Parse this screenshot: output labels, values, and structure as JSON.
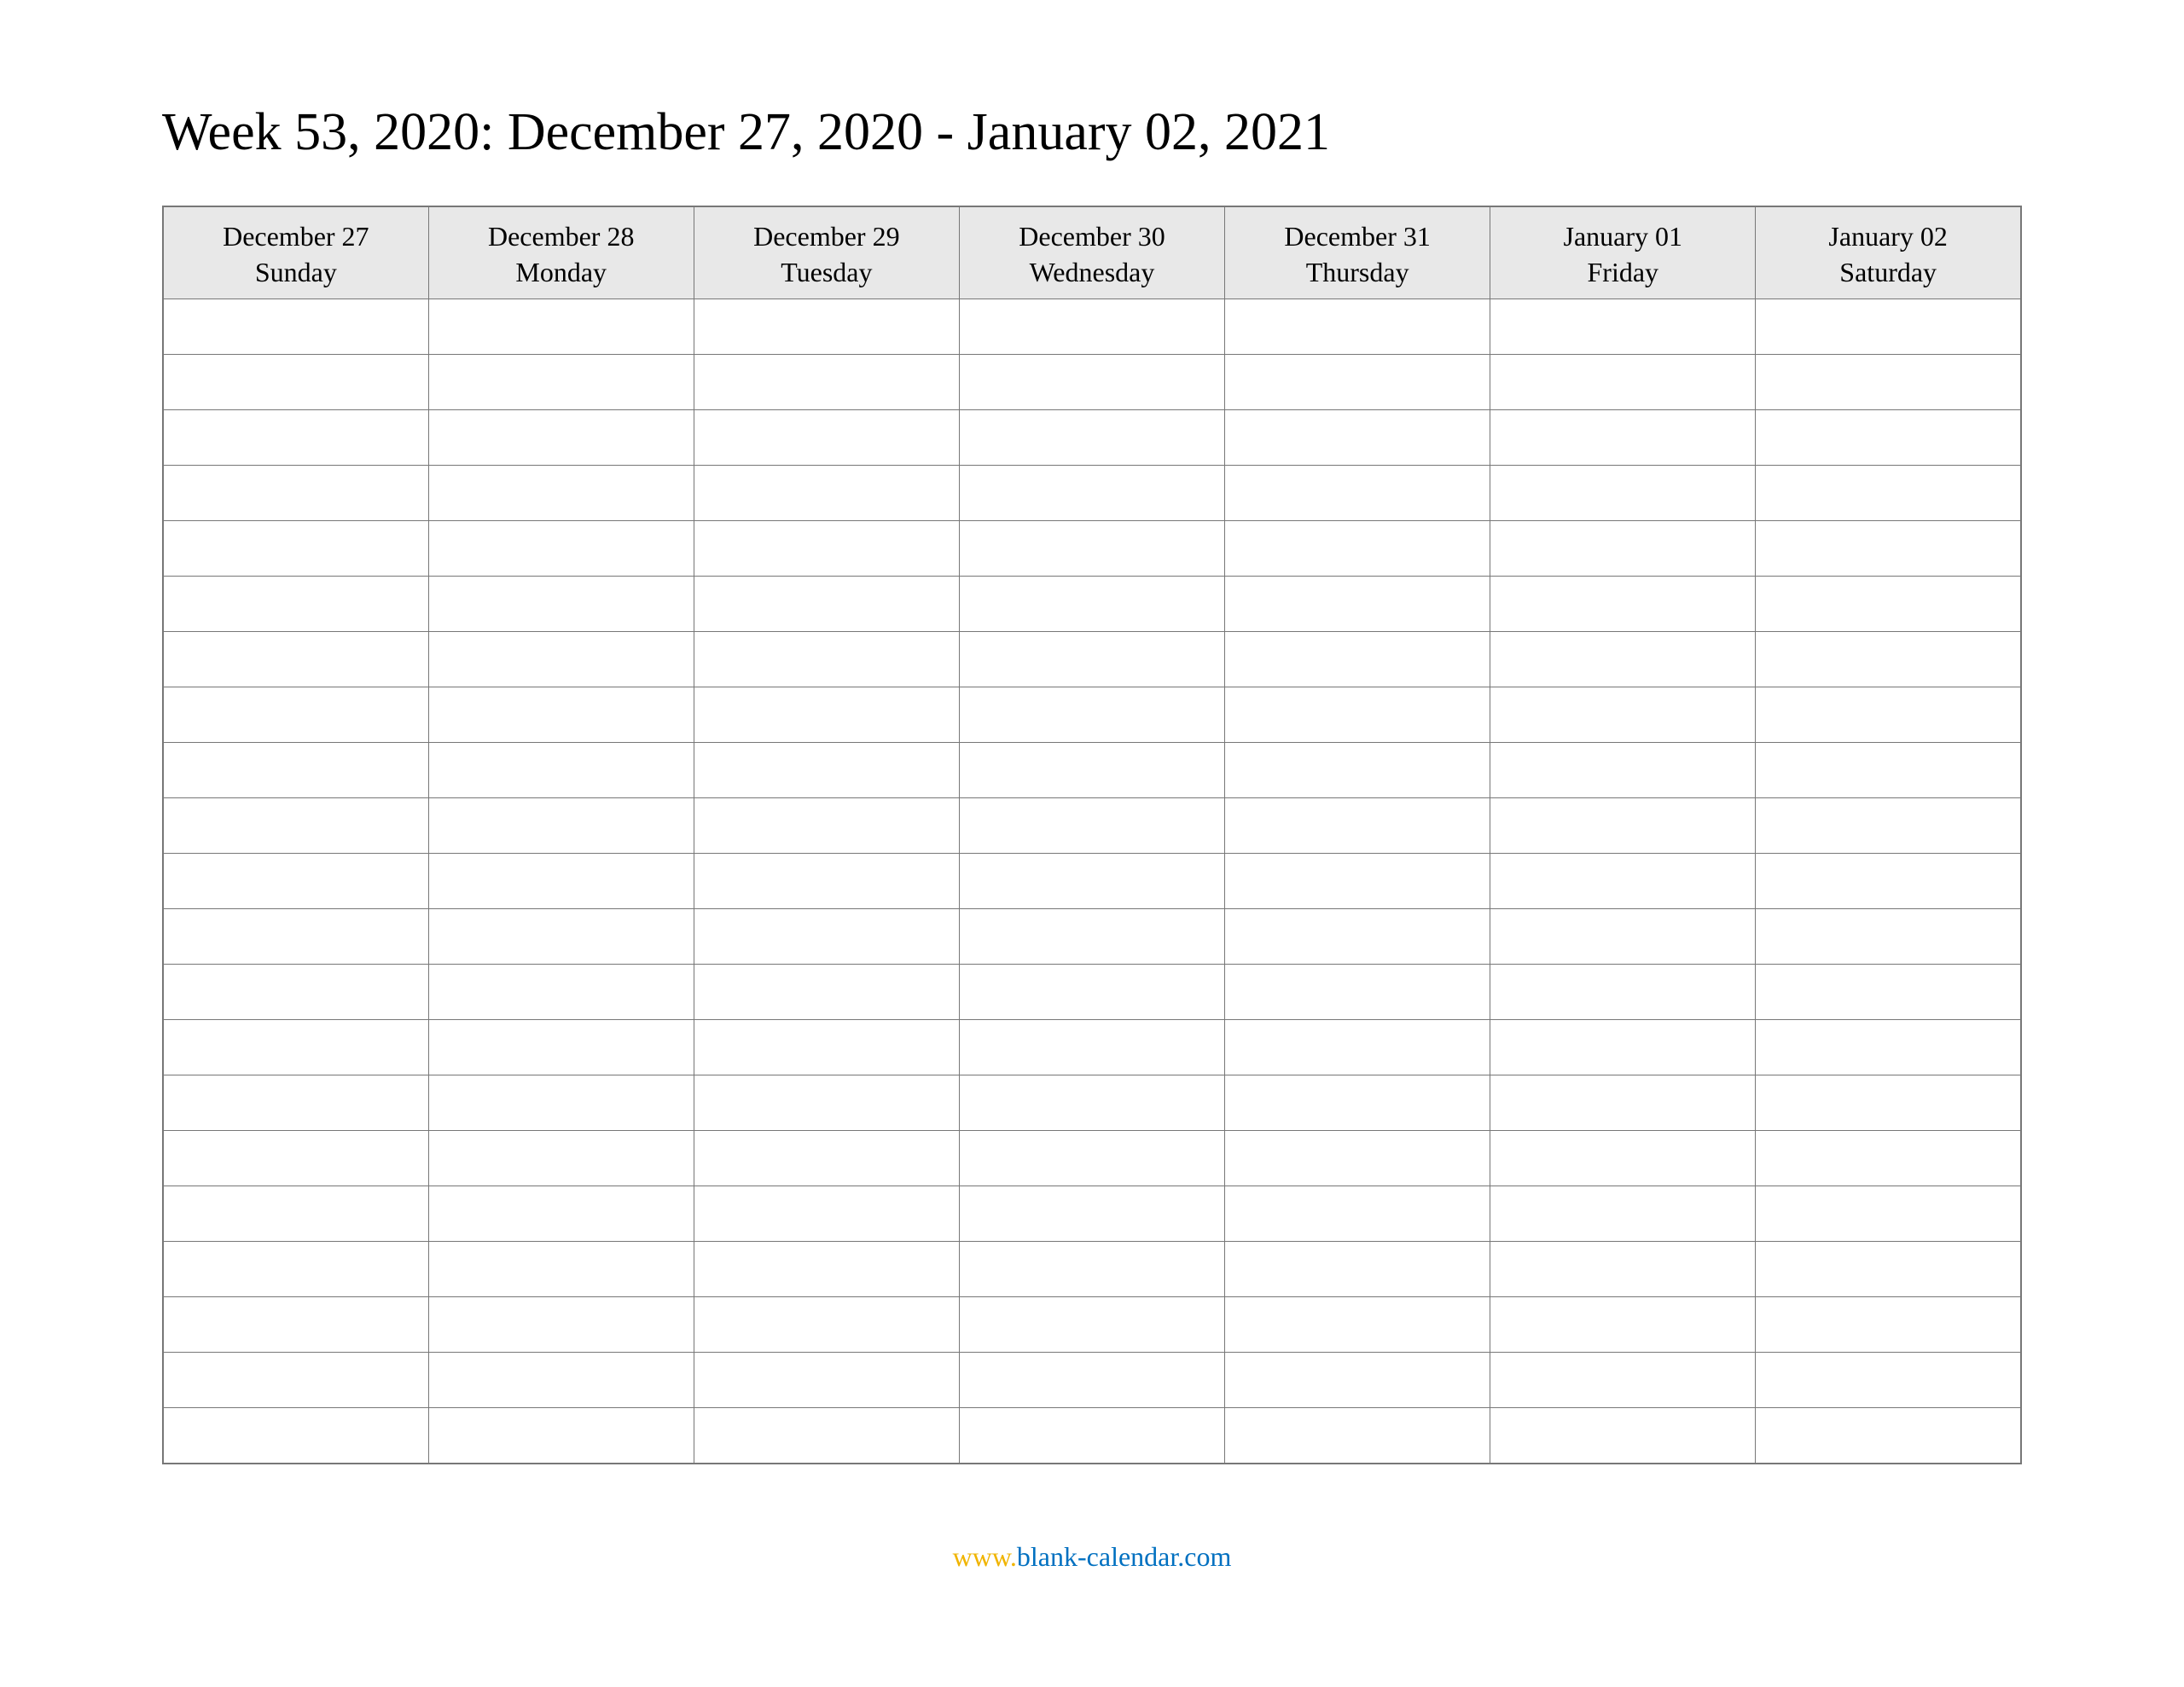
{
  "title": "Week 53, 2020: December 27, 2020 - January 02, 2021",
  "columns": [
    {
      "date": "December 27",
      "day": "Sunday"
    },
    {
      "date": "December 28",
      "day": "Monday"
    },
    {
      "date": "December 29",
      "day": "Tuesday"
    },
    {
      "date": "December 30",
      "day": "Wednesday"
    },
    {
      "date": "December 31",
      "day": "Thursday"
    },
    {
      "date": "January 01",
      "day": "Friday"
    },
    {
      "date": "January 02",
      "day": "Saturday"
    }
  ],
  "row_count": 21,
  "footer": {
    "www": "www.",
    "domain": "blank-calendar.com"
  }
}
